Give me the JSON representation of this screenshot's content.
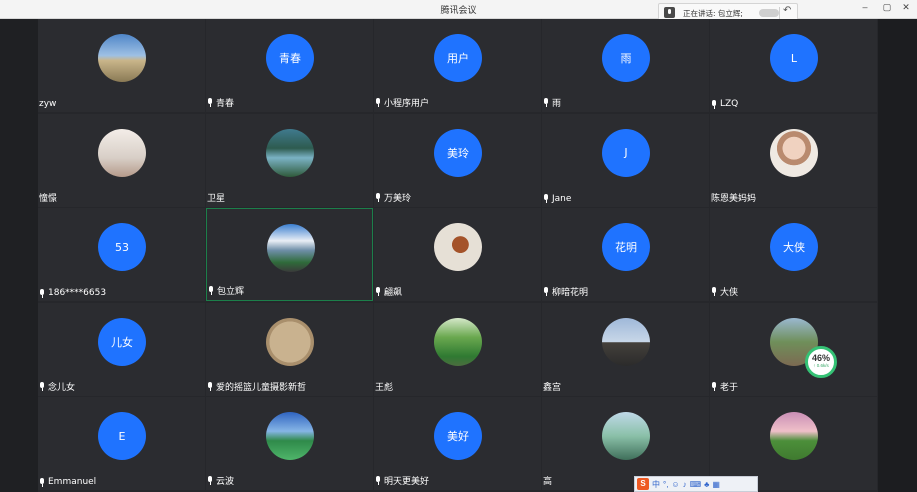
{
  "window": {
    "title": "腾讯会议",
    "speaking_label": "正在讲话: 包立辉;",
    "controls": [
      "–",
      "▢",
      "✕"
    ]
  },
  "colors": {
    "avatar_blue": "#1f73ff",
    "active_border": "#1c7f4a",
    "badge_green": "#35c275"
  },
  "participants": [
    {
      "name": "zyw",
      "avatar_text": "",
      "photo": "landscape",
      "mic": false
    },
    {
      "name": "青春",
      "avatar_text": "青春",
      "photo": "",
      "mic": true
    },
    {
      "name": "小程序用户",
      "avatar_text": "用户",
      "photo": "",
      "mic": true
    },
    {
      "name": "雨",
      "avatar_text": "雨",
      "photo": "",
      "mic": true
    },
    {
      "name": "LZQ",
      "avatar_text": "L",
      "photo": "",
      "mic": true
    },
    {
      "name": "憧憬",
      "avatar_text": "",
      "photo": "girl",
      "mic": false
    },
    {
      "name": "卫星",
      "avatar_text": "",
      "photo": "lake",
      "mic": false
    },
    {
      "name": "万美玲",
      "avatar_text": "美玲",
      "photo": "",
      "mic": true
    },
    {
      "name": "Jane",
      "avatar_text": "J",
      "photo": "",
      "mic": true
    },
    {
      "name": "陈恩美妈妈",
      "avatar_text": "",
      "photo": "woman",
      "mic": false
    },
    {
      "name": "186****6653",
      "avatar_text": "53",
      "photo": "",
      "mic": true
    },
    {
      "name": "包立辉",
      "avatar_text": "",
      "photo": "mountain",
      "mic": true,
      "active": true
    },
    {
      "name": "翩飙",
      "avatar_text": "",
      "photo": "rooster",
      "mic": true
    },
    {
      "name": "柳暗花明",
      "avatar_text": "花明",
      "photo": "",
      "mic": true
    },
    {
      "name": "大侠",
      "avatar_text": "大侠",
      "photo": "",
      "mic": true
    },
    {
      "name": "念儿女",
      "avatar_text": "儿女",
      "photo": "",
      "mic": true
    },
    {
      "name": "爱的摇篮儿童摄影新哲",
      "avatar_text": "",
      "photo": "coin",
      "mic": true
    },
    {
      "name": "王彪",
      "avatar_text": "",
      "photo": "trees",
      "mic": false
    },
    {
      "name": "鑫宫",
      "avatar_text": "",
      "photo": "person",
      "mic": false
    },
    {
      "name": "老于",
      "avatar_text": "",
      "photo": "village",
      "mic": true
    },
    {
      "name": "Emmanuel",
      "avatar_text": "E",
      "photo": "",
      "mic": true
    },
    {
      "name": "云波",
      "avatar_text": "",
      "photo": "lake2",
      "mic": true
    },
    {
      "name": "明天更美好",
      "avatar_text": "美好",
      "photo": "",
      "mic": true
    },
    {
      "name": "高",
      "avatar_text": "",
      "photo": "person2",
      "mic": false
    },
    {
      "name": "",
      "avatar_text": "",
      "photo": "field",
      "mic": false
    }
  ],
  "network_badge": {
    "percent": "46%",
    "rate": "↑ 0.6k/s"
  },
  "ime": {
    "letter": "S",
    "label": "中"
  }
}
